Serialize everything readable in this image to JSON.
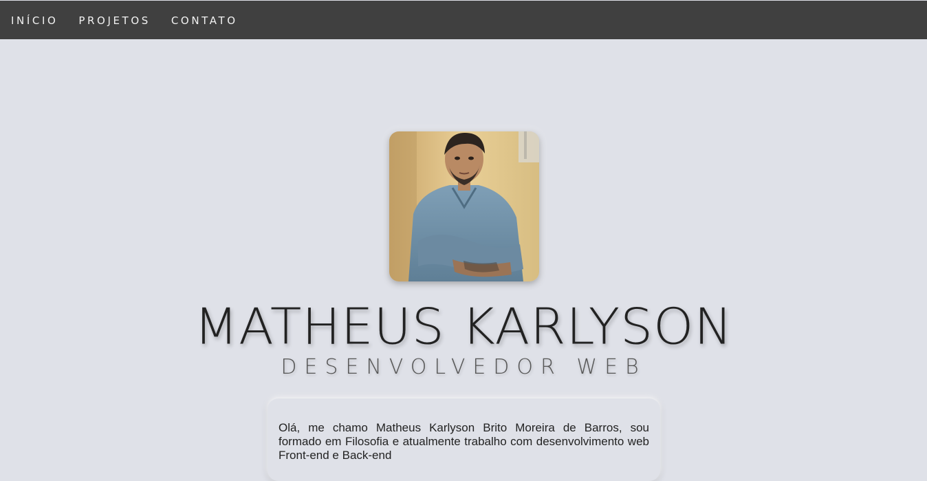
{
  "nav": {
    "items": [
      {
        "label": "INÍCIO"
      },
      {
        "label": "PROJETOS"
      },
      {
        "label": "CONTATO"
      }
    ]
  },
  "profile": {
    "name": "MATHEUS KARLYSON",
    "role": "DESENVOLVEDOR WEB",
    "about": "Olá, me chamo Matheus Karlyson Brito Moreira de Barros, sou formado em Filosofia e atualmente trabalho com desenvolvimento web Front-end e Back-end"
  },
  "colors": {
    "navbar": "#404040",
    "background": "#dfe1e8",
    "text": "#222222"
  }
}
